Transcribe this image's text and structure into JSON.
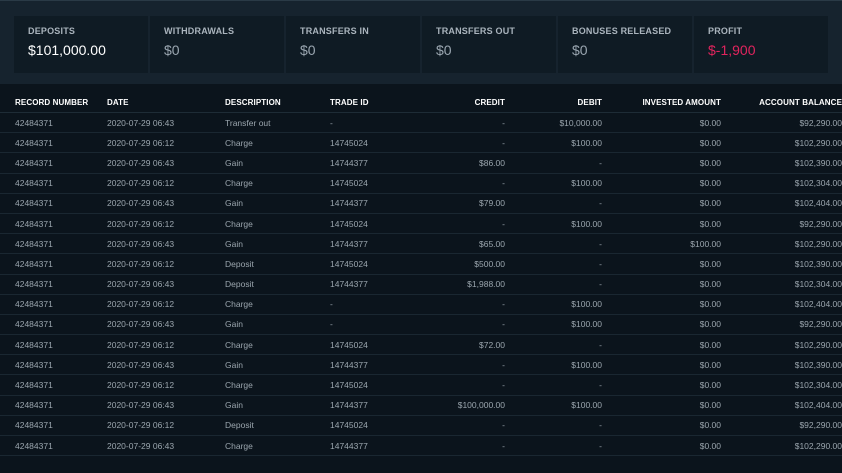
{
  "summary": {
    "cards": [
      {
        "label": "DEPOSITS",
        "value": "$101,000.00"
      },
      {
        "label": "WITHDRAWALS",
        "value": "$0"
      },
      {
        "label": "TRANSFERS IN",
        "value": "$0"
      },
      {
        "label": "TRANSFERS OUT",
        "value": "$0"
      },
      {
        "label": "BONUSES RELEASED",
        "value": "$0"
      },
      {
        "label": "PROFIT",
        "value": "$-1,900"
      }
    ]
  },
  "table": {
    "headers": [
      "RECORD NUMBER",
      "DATE",
      "DESCRIPTION",
      "TRADE ID",
      "CREDIT",
      "DEBIT",
      "INVESTED AMOUNT",
      "ACCOUNT BALANCE"
    ],
    "rows": [
      [
        "42484371",
        "2020-07-29 06:43",
        "Transfer out",
        "-",
        "-",
        "$10,000.00",
        "$0.00",
        "$92,290.00"
      ],
      [
        "42484371",
        "2020-07-29 06:12",
        "Charge",
        "14745024",
        "-",
        "$100.00",
        "$0.00",
        "$102,290.00"
      ],
      [
        "42484371",
        "2020-07-29 06:43",
        "Gain",
        "14744377",
        "$86.00",
        "-",
        "$0.00",
        "$102,390.00"
      ],
      [
        "42484371",
        "2020-07-29 06:12",
        "Charge",
        "14745024",
        "-",
        "$100.00",
        "$0.00",
        "$102,304.00"
      ],
      [
        "42484371",
        "2020-07-29 06:43",
        "Gain",
        "14744377",
        "$79.00",
        "-",
        "$0.00",
        "$102,404.00"
      ],
      [
        "42484371",
        "2020-07-29 06:12",
        "Charge",
        "14745024",
        "-",
        "$100.00",
        "$0.00",
        "$92,290.00"
      ],
      [
        "42484371",
        "2020-07-29 06:43",
        "Gain",
        "14744377",
        "$65.00",
        "-",
        "$100.00",
        "$102,290.00"
      ],
      [
        "42484371",
        "2020-07-29 06:12",
        "Deposit",
        "14745024",
        "$500.00",
        "-",
        "$0.00",
        "$102,390.00"
      ],
      [
        "42484371",
        "2020-07-29 06:43",
        "Deposit",
        "14744377",
        "$1,988.00",
        "-",
        "$0.00",
        "$102,304.00"
      ],
      [
        "42484371",
        "2020-07-29 06:12",
        "Charge",
        "-",
        "-",
        "$100.00",
        "$0.00",
        "$102,404.00"
      ],
      [
        "42484371",
        "2020-07-29 06:43",
        "Gain",
        "-",
        "-",
        "$100.00",
        "$0.00",
        "$92,290.00"
      ],
      [
        "42484371",
        "2020-07-29 06:12",
        "Charge",
        "14745024",
        "$72.00",
        "-",
        "$0.00",
        "$102,290.00"
      ],
      [
        "42484371",
        "2020-07-29 06:43",
        "Gain",
        "14744377",
        "-",
        "$100.00",
        "$0.00",
        "$102,390.00"
      ],
      [
        "42484371",
        "2020-07-29 06:12",
        "Charge",
        "14745024",
        "-",
        "-",
        "$0.00",
        "$102,304.00"
      ],
      [
        "42484371",
        "2020-07-29 06:43",
        "Gain",
        "14744377",
        "$100,000.00",
        "$100.00",
        "$0.00",
        "$102,404.00"
      ],
      [
        "42484371",
        "2020-07-29 06:12",
        "Deposit",
        "14745024",
        "-",
        "-",
        "$0.00",
        "$92,290.00"
      ],
      [
        "42484371",
        "2020-07-29 06:43",
        "Charge",
        "14744377",
        "-",
        "-",
        "$0.00",
        "$102,290.00"
      ]
    ]
  },
  "colors": {
    "background": "#0b141c",
    "panel": "#16232e",
    "card": "#0f1b24",
    "negative": "#e0245e"
  }
}
